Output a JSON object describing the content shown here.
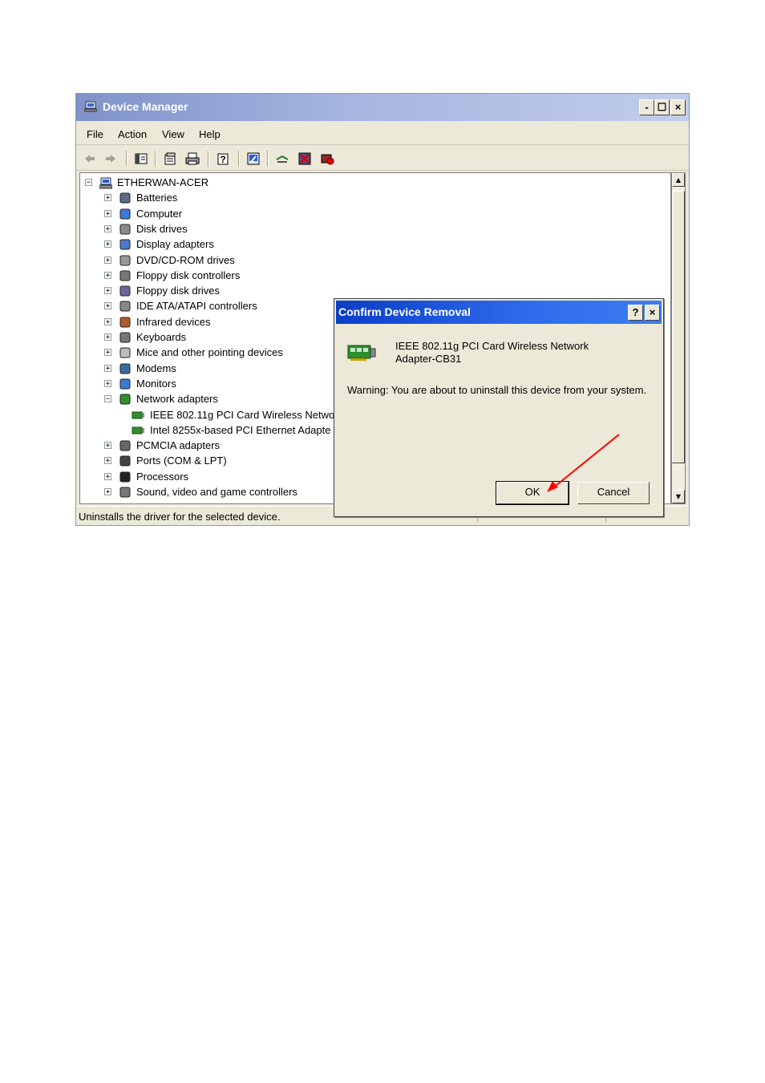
{
  "window": {
    "title": "Device Manager",
    "buttons": {
      "minimize": "-",
      "maximize": "☐",
      "close": "×"
    }
  },
  "menu": [
    "File",
    "Action",
    "View",
    "Help"
  ],
  "toolbar_icons": [
    "back-arrow-icon",
    "forward-arrow-icon",
    "show-hide-console-tree-icon",
    "properties-icon",
    "print-icon",
    "help-icon",
    "update-driver-icon",
    "scan-hardware-icon",
    "uninstall-icon",
    "disable-icon"
  ],
  "tree": {
    "root": "ETHERWAN-ACER",
    "items": [
      {
        "label": "Batteries",
        "icon": "battery-icon",
        "expanded": false
      },
      {
        "label": "Computer",
        "icon": "computer-icon",
        "expanded": false
      },
      {
        "label": "Disk drives",
        "icon": "disk-drive-icon",
        "expanded": false
      },
      {
        "label": "Display adapters",
        "icon": "display-adapter-icon",
        "expanded": false
      },
      {
        "label": "DVD/CD-ROM drives",
        "icon": "cdrom-icon",
        "expanded": false
      },
      {
        "label": "Floppy disk controllers",
        "icon": "floppy-controller-icon",
        "expanded": false
      },
      {
        "label": "Floppy disk drives",
        "icon": "floppy-drive-icon",
        "expanded": false
      },
      {
        "label": "IDE ATA/ATAPI controllers",
        "icon": "ide-controller-icon",
        "expanded": false
      },
      {
        "label": "Infrared devices",
        "icon": "infrared-icon",
        "expanded": false
      },
      {
        "label": "Keyboards",
        "icon": "keyboard-icon",
        "expanded": false
      },
      {
        "label": "Mice and other pointing devices",
        "icon": "mouse-icon",
        "expanded": false
      },
      {
        "label": "Modems",
        "icon": "modem-icon",
        "expanded": false
      },
      {
        "label": "Monitors",
        "icon": "monitor-icon",
        "expanded": false
      },
      {
        "label": "Network adapters",
        "icon": "network-adapter-icon",
        "expanded": true
      },
      {
        "label": "PCMCIA adapters",
        "icon": "pcmcia-icon",
        "expanded": false
      },
      {
        "label": "Ports (COM & LPT)",
        "icon": "ports-icon",
        "expanded": false
      },
      {
        "label": "Processors",
        "icon": "processor-icon",
        "expanded": false
      },
      {
        "label": "Sound, video and game controllers",
        "icon": "sound-icon",
        "expanded": false
      }
    ],
    "network_children": [
      "IEEE 802.11g PCI Card Wireless Netwo",
      "Intel 8255x-based PCI Ethernet Adapte"
    ]
  },
  "status": "Uninstalls the driver for the selected device.",
  "dialog": {
    "title": "Confirm Device Removal",
    "help_btn": "?",
    "close_btn": "×",
    "device_name": "IEEE 802.11g PCI Card Wireless Network Adapter-CB31",
    "warning": "Warning: You are about to uninstall this device from your system.",
    "ok": "OK",
    "cancel": "Cancel"
  },
  "colors": {
    "dialog_title": "#0a3ec6",
    "window_title": "#7f93c9",
    "annotation_arrow": "#ff0000"
  }
}
